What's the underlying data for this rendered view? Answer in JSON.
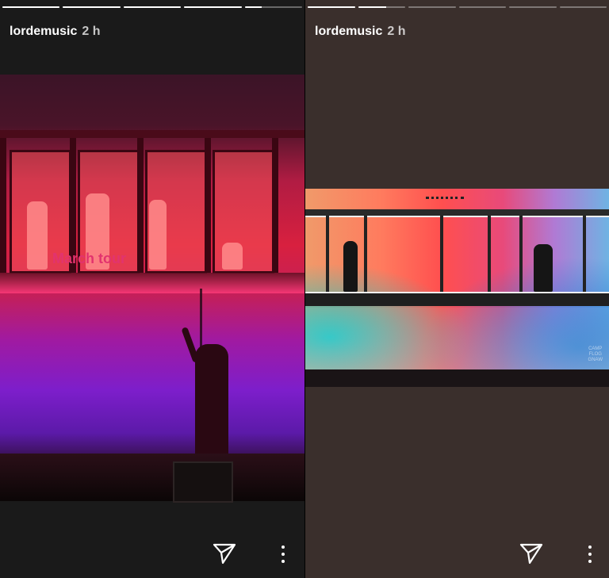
{
  "stories": [
    {
      "username": "lordemusic",
      "time": "2 h",
      "caption": "March tour",
      "progress": [
        1,
        1,
        1,
        1,
        0.3
      ]
    },
    {
      "username": "lordemusic",
      "time": "2 h",
      "progress": [
        1,
        0.6,
        0,
        0,
        0,
        0
      ],
      "logo_text": [
        "CAMP",
        "FLOG",
        "GNAW"
      ]
    }
  ],
  "icons": {
    "send": "paper-plane-icon",
    "more": "vertical-dots-icon"
  },
  "colors": {
    "caption": "#e2336e",
    "right_background": "#3a2f2c"
  }
}
